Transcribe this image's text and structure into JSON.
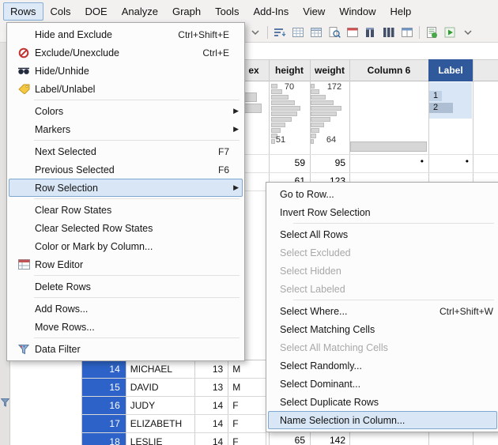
{
  "menubar": {
    "items": [
      {
        "label": "Rows"
      },
      {
        "label": "Cols"
      },
      {
        "label": "DOE"
      },
      {
        "label": "Analyze"
      },
      {
        "label": "Graph"
      },
      {
        "label": "Tools"
      },
      {
        "label": "Add-Ins"
      },
      {
        "label": "View"
      },
      {
        "label": "Window"
      },
      {
        "label": "Help"
      }
    ]
  },
  "toolbar": {
    "icons": [
      "overflow-chevron",
      "sort-lines",
      "grid",
      "grid-header",
      "zoom-document",
      "window-layout",
      "column-bars-a",
      "column-bars-b",
      "window-panes",
      "script-green",
      "run-script-green",
      "overflow-chevron-2"
    ]
  },
  "rows_menu": {
    "items": [
      {
        "label": "Hide and Exclude",
        "shortcut": "Ctrl+Shift+E"
      },
      {
        "label": "Exclude/Unexclude",
        "shortcut": "Ctrl+E"
      },
      {
        "label": "Hide/Unhide"
      },
      {
        "label": "Label/Unlabel"
      },
      {
        "label": "Colors"
      },
      {
        "label": "Markers"
      },
      {
        "label": "Next Selected",
        "shortcut": "F7"
      },
      {
        "label": "Previous Selected",
        "shortcut": "F6"
      },
      {
        "label": "Row Selection"
      },
      {
        "label": "Clear Row States"
      },
      {
        "label": "Clear Selected Row States"
      },
      {
        "label": "Color or Mark by Column..."
      },
      {
        "label": "Row Editor"
      },
      {
        "label": "Delete Rows"
      },
      {
        "label": "Add Rows..."
      },
      {
        "label": "Move Rows..."
      },
      {
        "label": "Data Filter"
      }
    ]
  },
  "row_selection_submenu": {
    "items": [
      {
        "label": "Go to Row..."
      },
      {
        "label": "Invert Row Selection"
      },
      {
        "label": "Select All Rows"
      },
      {
        "label": "Select Excluded",
        "disabled": true
      },
      {
        "label": "Select Hidden",
        "disabled": true
      },
      {
        "label": "Select Labeled",
        "disabled": true
      },
      {
        "label": "Select Where...",
        "shortcut": "Ctrl+Shift+W"
      },
      {
        "label": "Select Matching Cells"
      },
      {
        "label": "Select All Matching Cells",
        "disabled": true
      },
      {
        "label": "Select Randomly..."
      },
      {
        "label": "Select Dominant..."
      },
      {
        "label": "Select Duplicate Rows"
      },
      {
        "label": "Name Selection in Column..."
      }
    ]
  },
  "table": {
    "headers": {
      "sex_partial": "ex",
      "height": "height",
      "weight": "weight",
      "column6": "Column 6",
      "label": "Label"
    },
    "header_graphs": {
      "height_max": "70",
      "height_min": "51",
      "weight_max": "172",
      "weight_min": "64",
      "label_levels": [
        "1",
        "2"
      ]
    },
    "rows_visible_top": [
      {
        "height": "59",
        "weight": "95",
        "column6": "•",
        "label": "•"
      },
      {
        "height": "61",
        "weight": "123"
      }
    ],
    "rows_bottom": [
      {
        "num": "14",
        "name": "MICHAEL",
        "age": "13",
        "sex": "M"
      },
      {
        "num": "15",
        "name": "DAVID",
        "age": "13",
        "sex": "M"
      },
      {
        "num": "16",
        "name": "JUDY",
        "age": "14",
        "sex": "F"
      },
      {
        "num": "17",
        "name": "ELIZABETH",
        "age": "14",
        "sex": "F"
      },
      {
        "num": "18",
        "name": "LESLIE",
        "age": "14",
        "sex": "F",
        "height": "65",
        "weight": "142"
      }
    ]
  },
  "colors": {
    "selection_blue": "#2d63c8",
    "selected_header_blue": "#30599c",
    "menu_highlight": "#d8e6f5",
    "menu_highlight_border": "#7da7d1"
  }
}
